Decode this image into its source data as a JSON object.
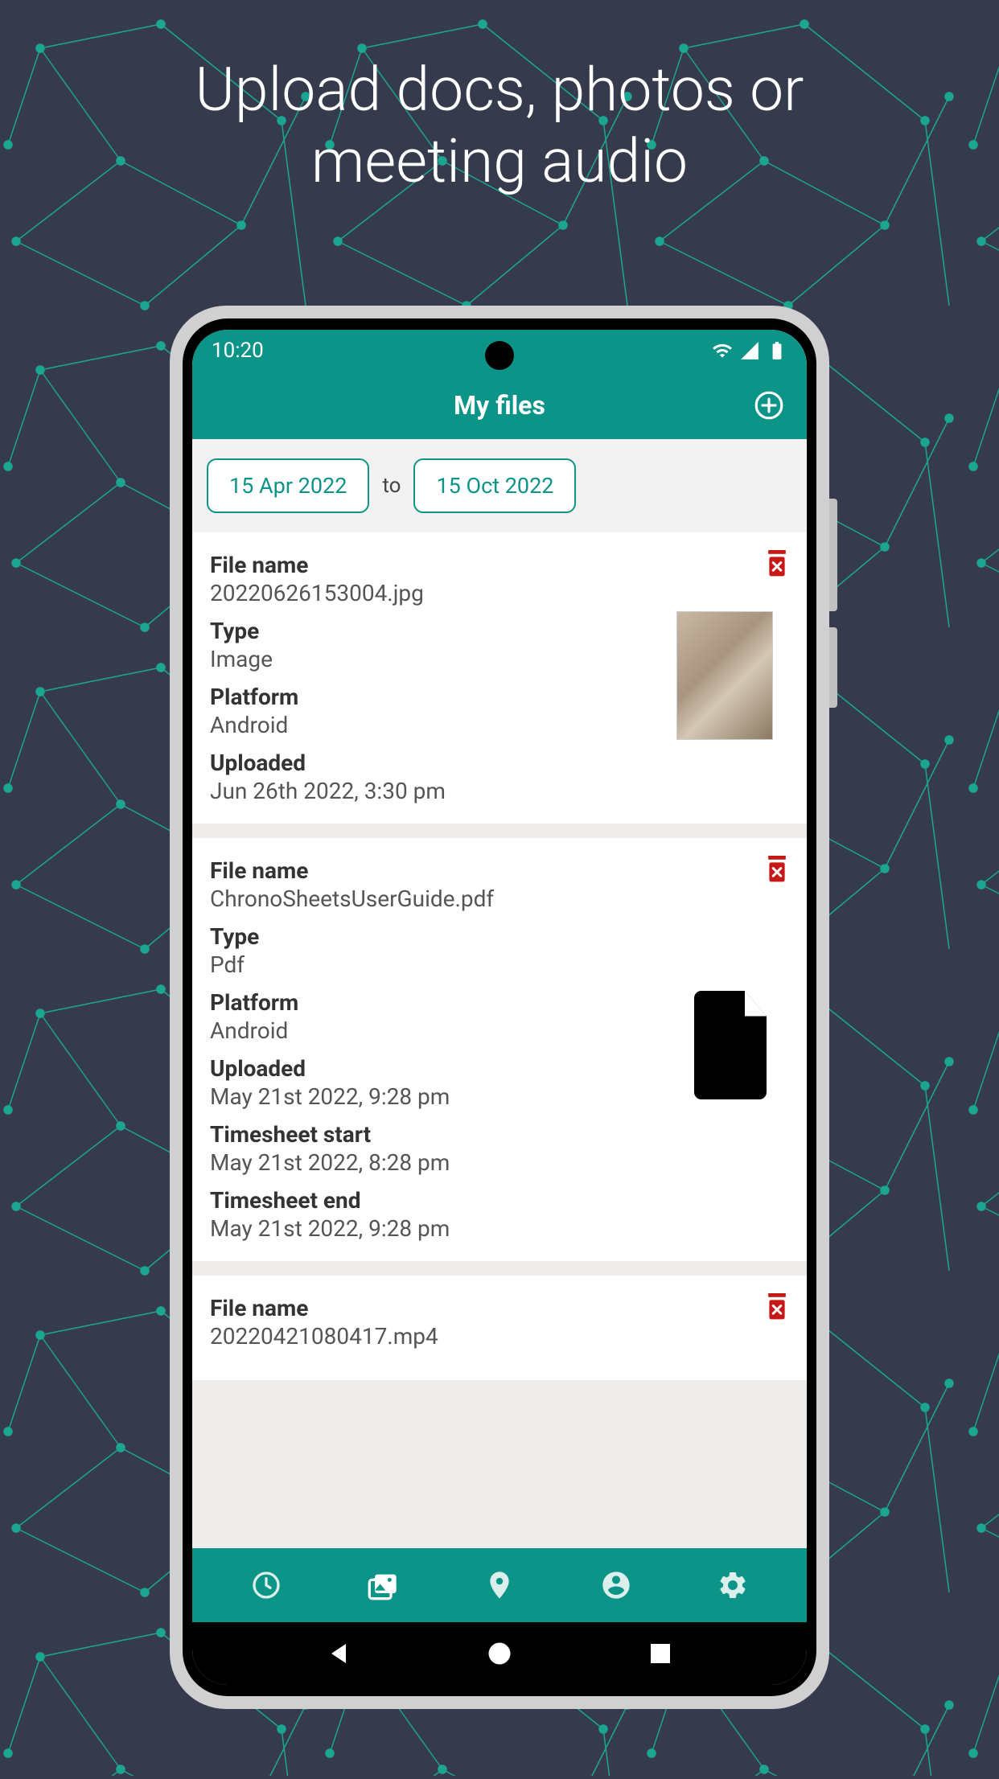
{
  "promo": {
    "headline": "Upload docs, photos or meeting audio"
  },
  "status": {
    "time": "10:20"
  },
  "header": {
    "title": "My files"
  },
  "filter": {
    "from": "15 Apr 2022",
    "sep": "to",
    "to": "15 Oct 2022"
  },
  "labels": {
    "file_name": "File name",
    "type": "Type",
    "platform": "Platform",
    "uploaded": "Uploaded",
    "timesheet_start": "Timesheet start",
    "timesheet_end": "Timesheet end"
  },
  "files": [
    {
      "file_name": "20220626153004.jpg",
      "type": "Image",
      "platform": "Android",
      "uploaded": "Jun 26th 2022, 3:30 pm"
    },
    {
      "file_name": "ChronoSheetsUserGuide.pdf",
      "type": "Pdf",
      "platform": "Android",
      "uploaded": "May 21st 2022, 9:28 pm",
      "timesheet_start": "May 21st 2022, 8:28 pm",
      "timesheet_end": "May 21st 2022, 9:28 pm"
    },
    {
      "file_name": "20220421080417.mp4"
    }
  ],
  "colors": {
    "accent": "#0d9488",
    "danger": "#c71818"
  }
}
